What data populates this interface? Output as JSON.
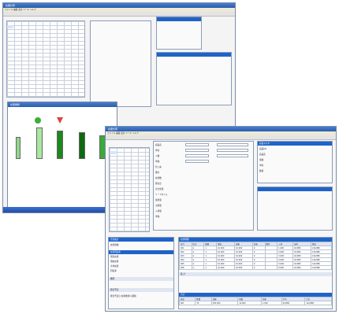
{
  "windows": {
    "back": {
      "title": "在庫計算",
      "menu": "ファイル 編集 表示 ツール ヘルプ"
    },
    "chart": {
      "title": "在庫推移"
    },
    "front": {
      "title": "在庫計算",
      "menu": "ファイル 編集 表示 ツール ヘルプ"
    }
  },
  "front": {
    "top_labels": [
      "商品名",
      "数量",
      "在庫数",
      "発注点",
      "安全在庫",
      "単価",
      "金額"
    ],
    "form_left": {
      "header": "商品情報",
      "rows": [
        "商品名",
        "単位",
        "入数",
        "単価",
        "仕入先",
        "備考",
        "在庫数",
        "発注点",
        "安全在庫",
        "リードタイム",
        "使用量",
        "出荷量",
        "入荷量",
        "単価"
      ]
    },
    "info_box": {
      "header": "商品マスタ",
      "rows": [
        "商品CD",
        "商品名",
        "規格",
        "単位",
        "数量"
      ]
    },
    "bottom_left": {
      "header1": "月次集計",
      "row1": "在庫金額",
      "header2": "在庫回転率",
      "labels": [
        "期首在庫",
        "期末在庫",
        "平均在庫",
        "回転率"
      ],
      "header3": "棚卸",
      "header4": "発注予定",
      "foot": "発注予定日 在庫推移(1週間)"
    },
    "bottom_right": {
      "header": "在庫明細",
      "cols": [
        "日付",
        "区分",
        "数量",
        "単価",
        "金額",
        "在庫",
        "備考",
        "入荷",
        "出荷",
        "残高"
      ],
      "rows": [
        [
          "001",
          "A",
          "1",
          "10,000",
          "10,000",
          "0",
          "",
          "1,000",
          "44,880",
          "144,880"
        ],
        [
          "002",
          "A",
          "1",
          "10,000",
          "10,000",
          "0",
          "",
          "2,000",
          "44,880",
          "144,880"
        ],
        [
          "003",
          "A",
          "1",
          "10,000",
          "10,000",
          "0",
          "",
          "3,000",
          "44,880",
          "144,880"
        ],
        [
          "004",
          "A",
          "1",
          "10,000",
          "10,000",
          "0",
          "",
          "4,000",
          "44,880",
          "144,880"
        ],
        [
          "005",
          "A",
          "1",
          "10,000",
          "10,000",
          "0",
          "",
          "5,000",
          "44,880",
          "144,880"
        ],
        [
          "006",
          "A",
          "1",
          "10,000",
          "10,000",
          "0",
          "",
          "6,000",
          "44,880",
          "144,880"
        ]
      ],
      "sub_header": "集 計",
      "totals_header": "合計",
      "foot_cols": [
        "商品",
        "数量",
        "金額",
        "単価",
        "在庫",
        "平均",
        "合計"
      ],
      "foot_vals": [
        "001",
        "35",
        "350,000",
        "10,000",
        "1,000",
        "44,880",
        "144,880"
      ]
    }
  }
}
